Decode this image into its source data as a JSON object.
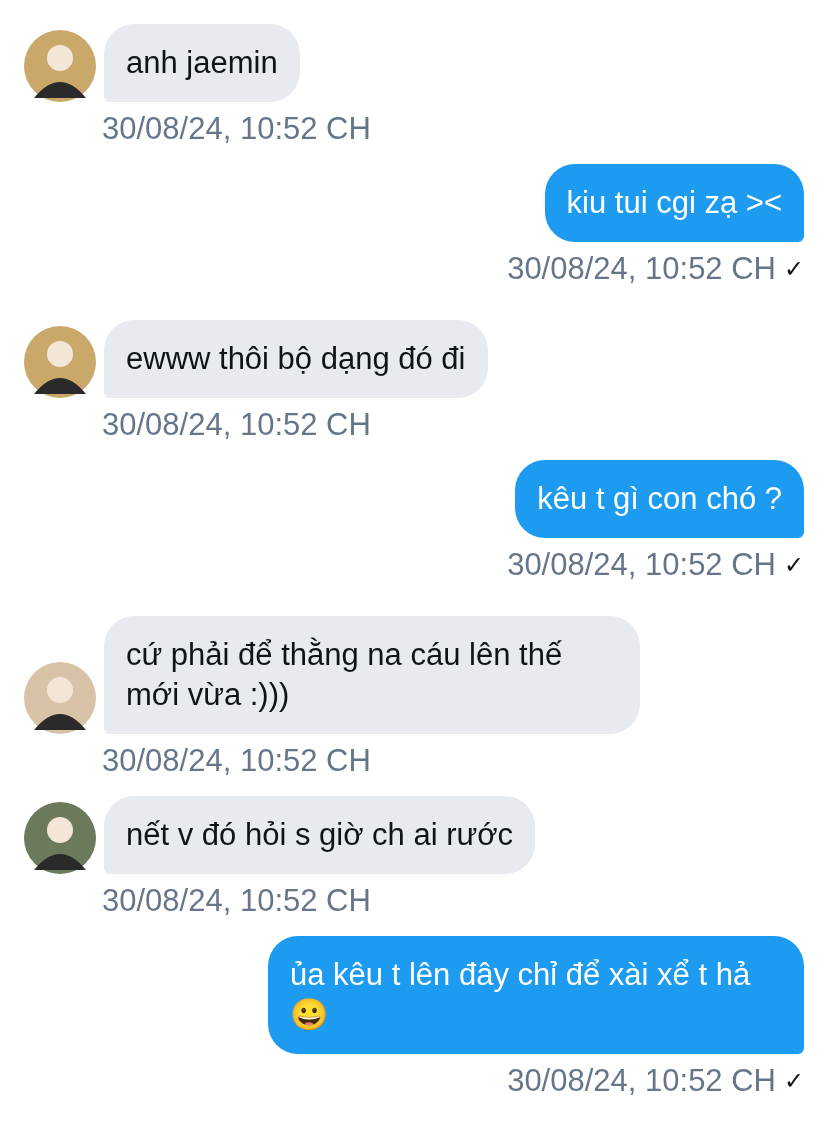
{
  "messages": [
    {
      "kind": "incoming",
      "text": "anh jaemin",
      "time": "30/08/24, 10:52 CH"
    },
    {
      "kind": "outgoing",
      "text": "kiu tui cgi zạ ><",
      "time": "30/08/24, 10:52 CH",
      "read_mark": "✓"
    },
    {
      "kind": "incoming",
      "text": "ewww thôi bộ dạng đó đi",
      "time": "30/08/24, 10:52 CH"
    },
    {
      "kind": "outgoing",
      "text": "kêu t gì con chó ?",
      "time": "30/08/24, 10:52 CH",
      "read_mark": "✓"
    },
    {
      "kind": "incoming",
      "text": "cứ phải để thằng na cáu lên thế mới vừa :)))",
      "time": "30/08/24, 10:52 CH"
    },
    {
      "kind": "incoming",
      "text": "nết v đó hỏi s giờ ch ai rước",
      "time": "30/08/24, 10:52 CH"
    },
    {
      "kind": "outgoing",
      "text": "ủa kêu t lên đây chỉ để xài xể t hả 😀",
      "time": "30/08/24, 10:52 CH",
      "read_mark": "✓"
    }
  ]
}
